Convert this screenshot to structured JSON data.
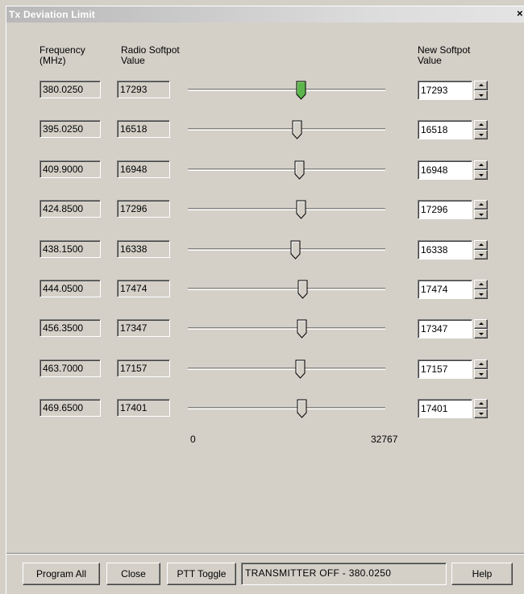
{
  "window": {
    "title": "Tx Deviation Limit",
    "close_glyph": "×"
  },
  "headers": {
    "frequency": [
      "Frequency",
      "(MHz)"
    ],
    "radio_softpot": [
      "Radio Softpot",
      "Value"
    ],
    "new_softpot": [
      "New Softpot",
      "Value"
    ]
  },
  "slider": {
    "min": 0,
    "max": 32767,
    "min_label": "0",
    "max_label": "32767",
    "active_color": "#5cb54a"
  },
  "rows": [
    {
      "frequency": "380.0250",
      "radio_value": "17293",
      "new_value": "17293",
      "slider_value": 17293,
      "active": true
    },
    {
      "frequency": "395.0250",
      "radio_value": "16518",
      "new_value": "16518",
      "slider_value": 16518,
      "active": false
    },
    {
      "frequency": "409.9000",
      "radio_value": "16948",
      "new_value": "16948",
      "slider_value": 16948,
      "active": false
    },
    {
      "frequency": "424.8500",
      "radio_value": "17296",
      "new_value": "17296",
      "slider_value": 17296,
      "active": false
    },
    {
      "frequency": "438.1500",
      "radio_value": "16338",
      "new_value": "16338",
      "slider_value": 16338,
      "active": false
    },
    {
      "frequency": "444.0500",
      "radio_value": "17474",
      "new_value": "17474",
      "slider_value": 17474,
      "active": false
    },
    {
      "frequency": "456.3500",
      "radio_value": "17347",
      "new_value": "17347",
      "slider_value": 17347,
      "active": false
    },
    {
      "frequency": "463.7000",
      "radio_value": "17157",
      "new_value": "17157",
      "slider_value": 17157,
      "active": false
    },
    {
      "frequency": "469.6500",
      "radio_value": "17401",
      "new_value": "17401",
      "slider_value": 17401,
      "active": false
    }
  ],
  "footer": {
    "program_all": "Program All",
    "close": "Close",
    "ptt_toggle": "PTT Toggle",
    "status": "TRANSMITTER OFF - 380.0250",
    "help": "Help"
  }
}
